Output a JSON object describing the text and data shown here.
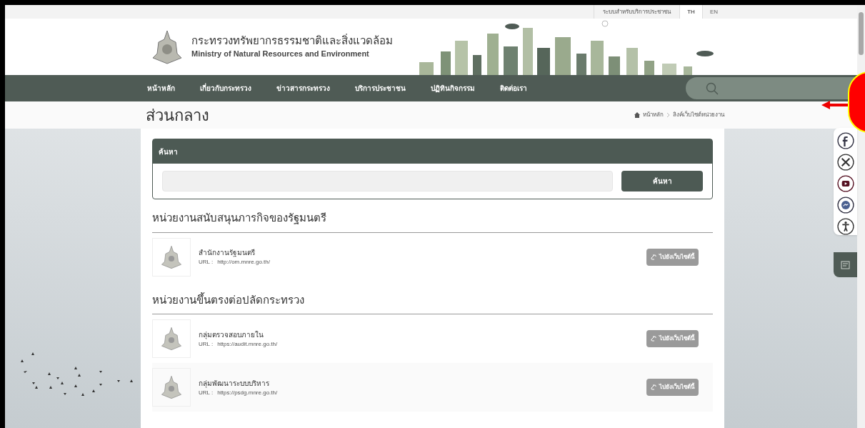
{
  "top_bar": {
    "service_link": "ระบบสำหรับบริการประชาชน",
    "languages": [
      {
        "label": "TH",
        "selected": true
      },
      {
        "label": "EN",
        "selected": false
      }
    ]
  },
  "header": {
    "title_th": "กระทรวงทรัพยากรธรรมชาติและสิ่งแวดล้อม",
    "title_en": "Ministry of Natural Resources and Environment"
  },
  "nav": {
    "items": [
      "หน้าหลัก",
      "เกี่ยวกับกระทรวง",
      "ข่าวสารกระทรวง",
      "บริการประชาชน",
      "ปฏิทินกิจกรรม",
      "ติดต่อเรา"
    ]
  },
  "page_title": "ส่วนกลาง",
  "breadcrumb": [
    "หน้าหลัก",
    "ลิงค์เว็บไซต์หน่วยงาน"
  ],
  "search_card": {
    "title": "ค้นหา",
    "button": "ค้นหา"
  },
  "sections": [
    {
      "heading": "หน่วยงานสนับสนุนภารกิจของรัฐมนตรี",
      "items": [
        {
          "name": "สำนักงานรัฐมนตรี",
          "url_label": "URL :",
          "url": "http://om.mnre.go.th/",
          "button": "ไปยังเว็บไซต์นี้"
        }
      ]
    },
    {
      "heading": "หน่วยงานขึ้นตรงต่อปลัดกระทรวง",
      "items": [
        {
          "name": "กลุ่มตรวจสอบภายใน",
          "url_label": "URL :",
          "url": "https://audit.mnre.go.th/",
          "button": "ไปยังเว็บไซต์นี้"
        },
        {
          "name": "กลุ่มพัฒนาระบบบริหาร",
          "url_label": "URL :",
          "url": "https://psdg.mnre.go.th/",
          "button": "ไปยังเว็บไซต์นี้"
        }
      ]
    }
  ],
  "social": [
    {
      "kind": "facebook"
    },
    {
      "kind": "x"
    },
    {
      "kind": "youtube"
    },
    {
      "kind": "messenger"
    },
    {
      "kind": "accessibility"
    }
  ]
}
